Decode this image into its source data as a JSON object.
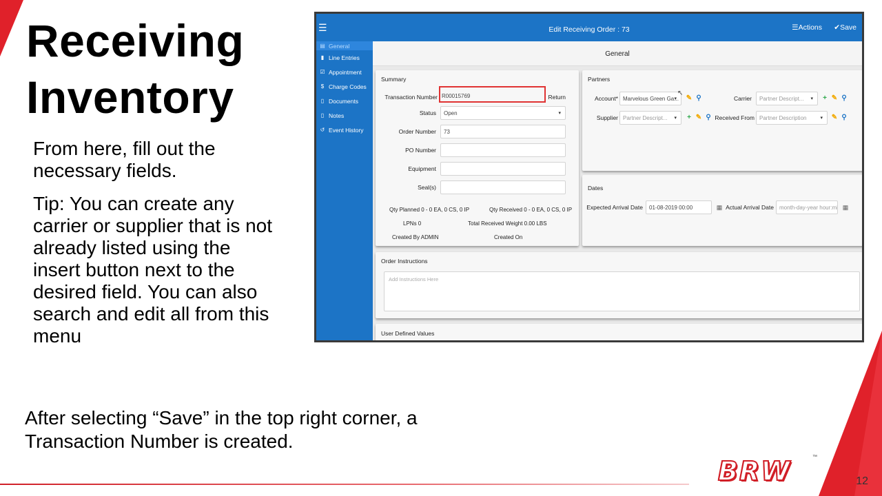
{
  "slide": {
    "title": "Receiving\nInventory",
    "paragraph1": "From here, fill out the necessary fields.",
    "paragraph2": "Tip: You can create any carrier or supplier that is not already listed using the insert button next to the desired field. You can also search and edit all from this menu",
    "bottom_text": "After selecting “Save” in the top right corner, a Transaction Number is created.",
    "page_number": "12",
    "logo_text": "BRW",
    "logo_tm": "™"
  },
  "app": {
    "title": "Edit Receiving Order : 73",
    "actions_label": "Actions",
    "save_label": "Save",
    "subheader": "General",
    "sidebar": [
      {
        "label": "General",
        "icon": "grid-icon",
        "glyph": "▤"
      },
      {
        "label": "Line Entries",
        "icon": "clipboard-icon",
        "glyph": "▮"
      },
      {
        "label": "Appointment",
        "icon": "calendar-check-icon",
        "glyph": "☑"
      },
      {
        "label": "Charge Codes",
        "icon": "dollar-icon",
        "glyph": "$"
      },
      {
        "label": "Documents",
        "icon": "document-icon",
        "glyph": "▯"
      },
      {
        "label": "Notes",
        "icon": "note-icon",
        "glyph": "▯"
      },
      {
        "label": "Event History",
        "icon": "history-icon",
        "glyph": "↺"
      }
    ],
    "summary": {
      "title": "Summary",
      "transaction_number_label": "Transaction Number",
      "transaction_number_value": "R00015769",
      "return_label": "Return",
      "status_label": "Status",
      "status_value": "Open",
      "order_number_label": "Order Number",
      "order_number_value": "73",
      "po_number_label": "PO Number",
      "po_number_value": "",
      "equipment_label": "Equipment",
      "equipment_value": "",
      "seals_label": "Seal(s)",
      "seals_value": "",
      "qty_planned": "Qty Planned  0 - 0 EA, 0 CS, 0 IP",
      "qty_received": "Qty Received  0 - 0 EA, 0 CS, 0 IP",
      "lpns": "LPNs  0",
      "total_received_weight": "Total Received Weight  0.00 LBS",
      "created_by": "Created By  ADMIN",
      "created_on": "Created On"
    },
    "partners": {
      "title": "Partners",
      "account_label": "Account*",
      "account_value": "Marvelous Green Ga...",
      "carrier_label": "Carrier",
      "carrier_placeholder": "Partner Descript...",
      "supplier_label": "Supplier",
      "supplier_placeholder": "Partner Descript...",
      "received_from_label": "Received From",
      "received_from_placeholder": "Partner Description"
    },
    "dates": {
      "title": "Dates",
      "expected_label": "Expected Arrival Date",
      "expected_value": "01-08-2019 00:00",
      "actual_label": "Actual Arrival Date",
      "actual_placeholder": "month-day-year hour:mi..."
    },
    "order_instructions": {
      "title": "Order Instructions",
      "placeholder": "Add Instructions Here"
    },
    "user_defined": {
      "title": "User Defined Values"
    },
    "icons": {
      "menu": "☰",
      "actions": "☰",
      "save": "✔",
      "caret": "▾",
      "plus": "+",
      "edit": "✎",
      "search": "⚲",
      "calendar": "▦",
      "cursor": "↖"
    },
    "colors": {
      "header_blue": "#1c74c6",
      "highlight_red": "#e03232",
      "brand_red": "#e0212a"
    }
  }
}
